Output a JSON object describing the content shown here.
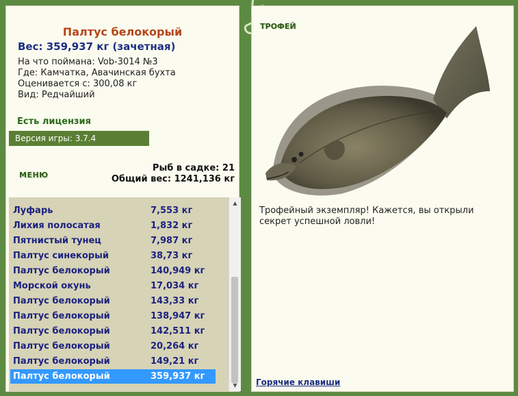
{
  "fish": {
    "title": "Палтус белокорый",
    "weight": "Вес: 359,937 кг (зачетная)",
    "bait": "На что поймана: Vob-3014 №3",
    "location": "Где: Камчатка, Авачинская бухта",
    "price": "Оценивается с: 300,08 кг",
    "rarity": "Вид: Редчайший"
  },
  "license": "Есть лицензия",
  "version": "Версия игры: 3.7.4",
  "menu_label": "МЕНЮ",
  "stats": {
    "count": "Рыб в садке: 21",
    "total": "Общий вес: 1241,136 кг"
  },
  "catch": [
    {
      "name": "Луфарь",
      "weight": "7,553 кг"
    },
    {
      "name": "Лихия полосатая",
      "weight": "1,832 кг"
    },
    {
      "name": "Пятнистый тунец",
      "weight": "7,987 кг"
    },
    {
      "name": "Палтус синекорый",
      "weight": "38,73 кг"
    },
    {
      "name": "Палтус белокорый",
      "weight": "140,949 кг"
    },
    {
      "name": "Морской окунь",
      "weight": "17,034 кг"
    },
    {
      "name": "Палтус белокорый",
      "weight": "143,33 кг"
    },
    {
      "name": "Палтус белокорый",
      "weight": "138,947 кг"
    },
    {
      "name": "Палтус белокорый",
      "weight": "142,511 кг"
    },
    {
      "name": "Палтус белокорый",
      "weight": "20,264 кг"
    },
    {
      "name": "Палтус белокорый",
      "weight": "149,21 кг"
    },
    {
      "name": "Палтус белокорый",
      "weight": "359,937 кг"
    }
  ],
  "selected_index": 11,
  "trophy": {
    "label": "ТРОФЕЙ",
    "text": "Трофейный экземпляр! Кажется, вы открыли секрет успешной ловли!"
  },
  "hotkeys": "Горячие клавиши",
  "icons": {
    "up": "scroll-up-icon",
    "down": "scroll-down-icon"
  },
  "colors": {
    "frame": "#5d8a42",
    "title": "#b5471a",
    "weight": "#1c2f80",
    "selected": "#3399ff",
    "list_bg": "#d6d3b6"
  }
}
